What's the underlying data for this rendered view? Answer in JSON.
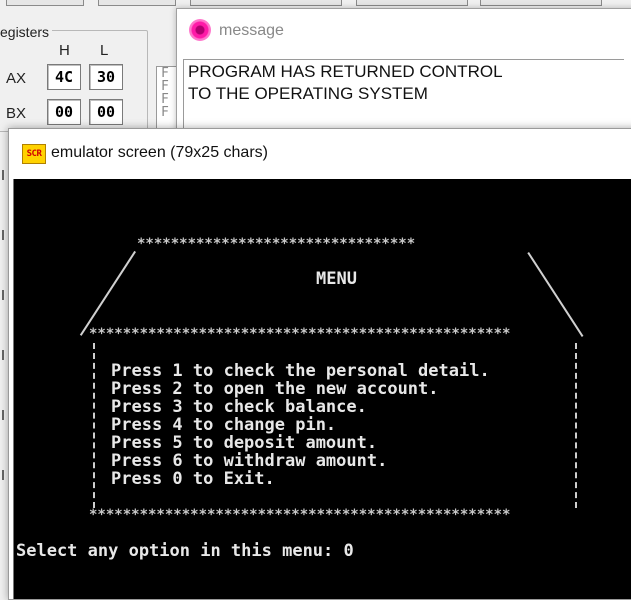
{
  "registers": {
    "title": "egisters",
    "col_h": "H",
    "col_l": "L",
    "rows": [
      {
        "name": "AX",
        "h": "4C",
        "l": "30"
      },
      {
        "name": "BX",
        "h": "00",
        "l": "00"
      }
    ],
    "side_chars": [
      "F",
      "F",
      "F",
      "F"
    ]
  },
  "message_window": {
    "icon": "message-icon",
    "title": "message",
    "lines": [
      "PROGRAM HAS RETURNED CONTROL",
      "TO THE OPERATING SYSTEM"
    ]
  },
  "emulator_window": {
    "icon_text": "SCR",
    "title": "emulator screen (79x25 chars)",
    "top_stars": "*********************************",
    "menu_title": "MENU",
    "middle_stars": "**************************************************",
    "options": [
      "Press 1 to check the personal detail.",
      "Press 2 to open the new account.",
      "Press 3 to check balance.",
      "Press 4 to change pin.",
      "Press 5 to deposit amount.",
      "Press 6 to withdraw amount.",
      "Press 0 to Exit."
    ],
    "bottom_stars": "**************************************************",
    "prompt": "Select any option in this menu: 0"
  },
  "colors": {
    "console_bg": "#000000",
    "console_fg": "#e8e8e8",
    "message_icon": "#ff1aa8",
    "emu_icon_bg": "#ffd200"
  }
}
